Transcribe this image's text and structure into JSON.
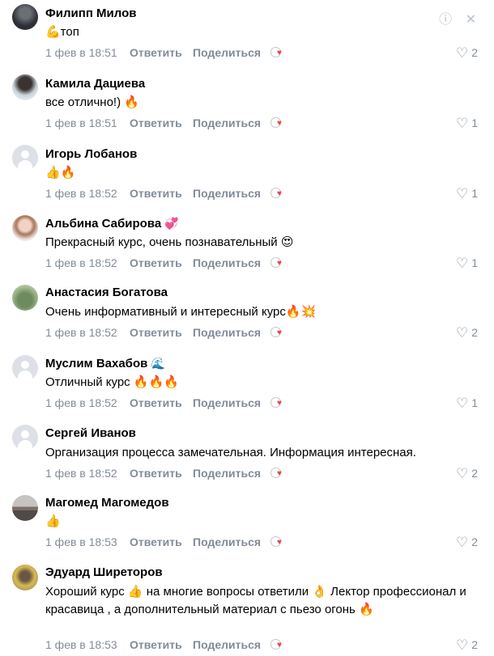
{
  "comments": [
    {
      "name": "Филипп Милов",
      "text": "💪топ",
      "date": "1 фев в 18:51",
      "likes": "2"
    },
    {
      "name": "Камила Дациева",
      "text": "все отлично!) 🔥",
      "date": "1 фев в 18:51",
      "likes": "1"
    },
    {
      "name": "Игорь Лобанов",
      "text": "👍🔥",
      "date": "1 фев в 18:52",
      "likes": "1"
    },
    {
      "name": "Альбина Сабирова",
      "badge": "💞",
      "text": "Прекрасный курс, очень познавательный 😍",
      "date": "1 фев в 18:52",
      "likes": "1"
    },
    {
      "name": "Анастасия Богатова",
      "text": "Очень информативный и интересный курс🔥💥",
      "date": "1 фев в 18:52",
      "likes": "2"
    },
    {
      "name": "Муслим Вахабов",
      "badge": "🌊",
      "text": "Отличный курс 🔥🔥🔥",
      "date": "1 фев в 18:52",
      "likes": "1"
    },
    {
      "name": "Сергей Иванов",
      "text": "Организация процесса замечательная. Информация интересная.",
      "date": "1 фев в 18:52",
      "likes": "2"
    },
    {
      "name": "Магомед Магомедов",
      "text": "👍",
      "date": "1 фев в 18:53",
      "likes": "2"
    },
    {
      "name": "Эдуард Ширеторов",
      "text": "Хороший курс 👍 на многие вопросы ответили 👌 Лектор профессионал и красавица , а дополнительный материал с пьезо огонь 🔥",
      "date": "1 фев в 18:53",
      "likes": "2"
    }
  ],
  "actions": {
    "reply": "Ответить",
    "share": "Поделиться"
  },
  "icons": {
    "report": "warning-circle-icon",
    "close": "close-icon",
    "like": "heart-outline-icon",
    "react": "reaction-icon"
  },
  "colors": {
    "meta": "#818c99",
    "heart": "#e64646"
  }
}
